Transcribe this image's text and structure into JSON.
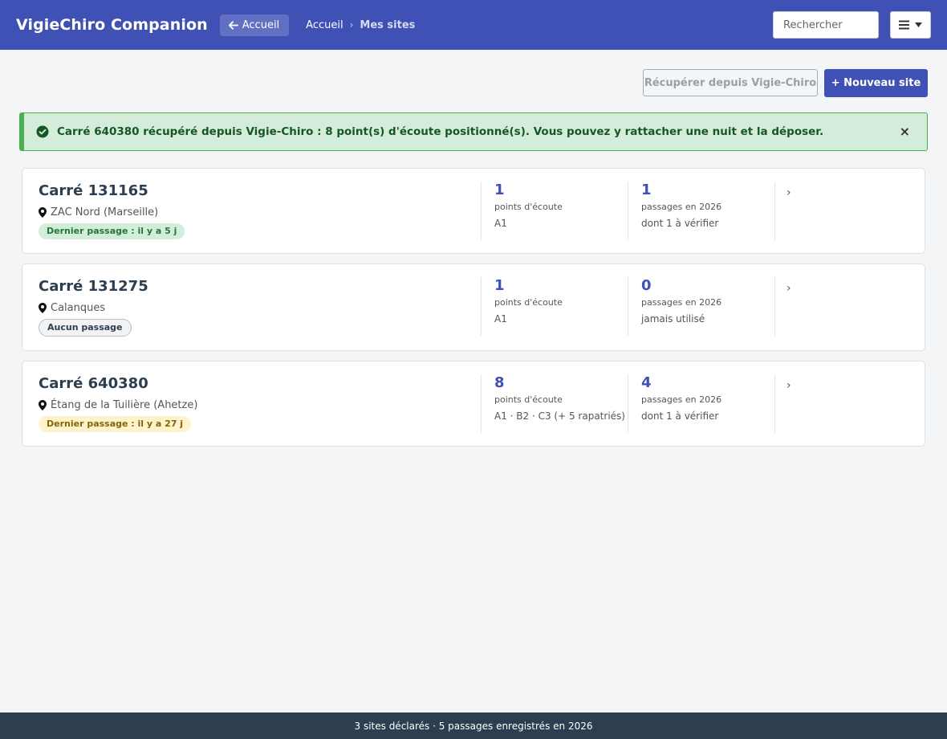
{
  "app": {
    "title": "VigieChiro Companion",
    "back_label": "Accueil"
  },
  "breadcrumb": {
    "home": "Accueil",
    "separator": "›",
    "current": "Mes sites"
  },
  "search": {
    "placeholder": "Rechercher",
    "value": ""
  },
  "actions": {
    "fetch_label": "Récupérer depuis Vigie-Chiro",
    "new_site_label": "+ Nouveau site"
  },
  "alert": {
    "message": "Carré 640380 récupéré depuis Vigie-Chiro : 8 point(s) d'écoute positionné(s). Vous pouvez y rattacher une nuit et la déposer.",
    "close": "×"
  },
  "sites": [
    {
      "title": "Carré 131165",
      "location": "ZAC Nord (Marseille)",
      "badge": "Dernier passage : il y a 5 j",
      "points_count": "1",
      "points_label": "points d'écoute",
      "points_detail": "A1",
      "passages_count": "1",
      "passages_label": "passages en 2026",
      "passages_detail": "dont 1 à vérifier",
      "chevron": "›"
    },
    {
      "title": "Carré 131275",
      "location": "Calanques",
      "badge": "Aucun passage",
      "points_count": "1",
      "points_label": "points d'écoute",
      "points_detail": "A1",
      "passages_count": "0",
      "passages_label": "passages en 2026",
      "passages_detail": "jamais utilisé",
      "chevron": "›"
    },
    {
      "title": "Carré 640380",
      "location": "Étang de la Tuilière (Ahetze)",
      "badge": "Dernier passage : il y a 27 j",
      "points_count": "8",
      "points_label": "points d'écoute",
      "points_detail": "A1 · B2 · C3  (+ 5 rapatriés)",
      "passages_count": "4",
      "passages_label": "passages en 2026",
      "passages_detail": "dont 1 à vérifier",
      "chevron": "›"
    }
  ],
  "footer": {
    "text": "3 sites déclarés · 5 passages enregistrés en 2026"
  },
  "colors": {
    "primary": "#3f51b5",
    "success": "#4caf50",
    "footer": "#2c3e50"
  },
  "icons": {
    "back": "arrow-left-icon",
    "menu": "hamburger-icon",
    "dropdown": "caret-down-icon",
    "alert": "check-circle-icon",
    "location": "map-marker-icon",
    "chevron": "chevron-right-icon"
  }
}
